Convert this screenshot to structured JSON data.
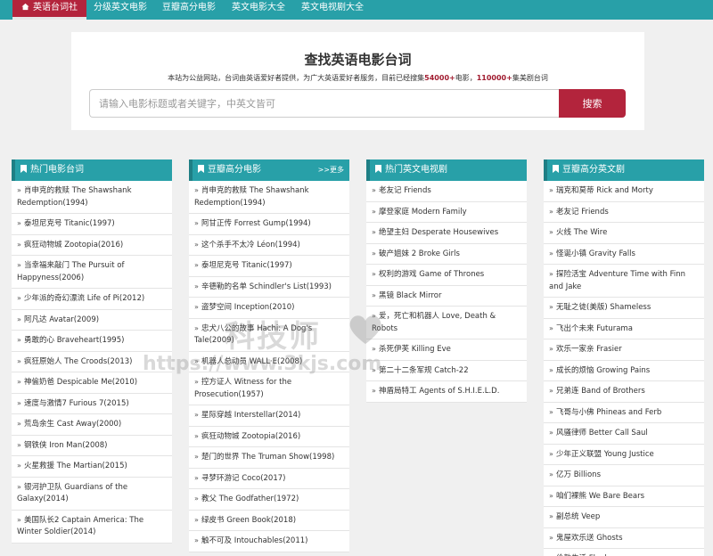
{
  "nav": {
    "items": [
      {
        "label": "英语台词社"
      },
      {
        "label": "分级英文电影"
      },
      {
        "label": "豆瓣高分电影"
      },
      {
        "label": "英文电影大全"
      },
      {
        "label": "英文电视剧大全"
      }
    ]
  },
  "search": {
    "title": "查找英语电影台词",
    "desc_pre": "本站为公益网站，台词由英语爱好者提供，为广大英语爱好者服务，目前已经搜集",
    "movie_count": "54000+",
    "desc_mid": "电影，",
    "series_count": "110000+",
    "desc_post": "集美剧台词",
    "placeholder": "请输入电影标题或者关键字，中英文皆可",
    "button_label": "搜索"
  },
  "panels": [
    {
      "title": "热门电影台词",
      "more": "",
      "items": [
        "肖申克的救赎 The Shawshank Redemption(1994)",
        "泰坦尼克号 Titanic(1997)",
        "疯狂动物城 Zootopia(2016)",
        "当幸福来敲门 The Pursuit of Happyness(2006)",
        "少年派的奇幻漂流 Life of Pi(2012)",
        "阿凡达 Avatar(2009)",
        "勇敢的心 Braveheart(1995)",
        "疯狂原始人 The Croods(2013)",
        "神偷奶爸 Despicable Me(2010)",
        "速度与激情7 Furious 7(2015)",
        "荒岛余生 Cast Away(2000)",
        "钢铁侠 Iron Man(2008)",
        "火星救援 The Martian(2015)",
        "银河护卫队 Guardians of the Galaxy(2014)",
        "美国队长2 Captain America: The Winter Soldier(2014)"
      ]
    },
    {
      "title": "豆瓣高分电影",
      "more": ">>更多",
      "items": [
        "肖申克的救赎 The Shawshank Redemption(1994)",
        "阿甘正传 Forrest Gump(1994)",
        "这个杀手不太冷 Léon(1994)",
        "泰坦尼克号 Titanic(1997)",
        "辛德勒的名单 Schindler's List(1993)",
        "盗梦空间 Inception(2010)",
        "忠犬八公的故事 Hachi: A Dog's Tale(2009)",
        "机器人总动员 WALL·E(2008)",
        "控方证人 Witness for the Prosecution(1957)",
        "星际穿越 Interstellar(2014)",
        "疯狂动物城 Zootopia(2016)",
        "楚门的世界 The Truman Show(1998)",
        "寻梦环游记 Coco(2017)",
        "教父 The Godfather(1972)",
        "绿皮书 Green Book(2018)",
        "触不可及 Intouchables(2011)"
      ]
    },
    {
      "title": "热门英文电视剧",
      "more": "",
      "items": [
        "老友记 Friends",
        "摩登家庭 Modern Family",
        "绝望主妇 Desperate Housewives",
        "破产姐妹 2 Broke Girls",
        "权利的游戏 Game of Thrones",
        "黑镜 Black Mirror",
        "爱，死亡和机器人 Love, Death & Robots",
        "杀死伊芙 Killing Eve",
        "第二十二条军规 Catch-22",
        "神盾局特工 Agents of S.H.I.E.L.D."
      ]
    },
    {
      "title": "豆瓣高分英文剧",
      "more": "",
      "items": [
        "瑞克和莫蒂 Rick and Morty",
        "老友记 Friends",
        "火线 The Wire",
        "怪诞小镇 Gravity Falls",
        "探险活宝 Adventure Time with Finn and Jake",
        "无耻之徒(美版) Shameless",
        "飞出个未来 Futurama",
        "欢乐一家亲 Frasier",
        "成长的烦恼 Growing Pains",
        "兄弟连 Band of Brothers",
        "飞哥与小佛 Phineas and Ferb",
        "风骚律师 Better Call Saul",
        "少年正义联盟 Young Justice",
        "亿万 Billions",
        "咱们裸熊 We Bare Bears",
        "副总统 Veep",
        "鬼屋欢乐送 Ghosts",
        "伦敦生活 Fleabag"
      ]
    }
  ],
  "watermark": {
    "brand": "科技师",
    "url": "https://www.3kjs.com"
  }
}
